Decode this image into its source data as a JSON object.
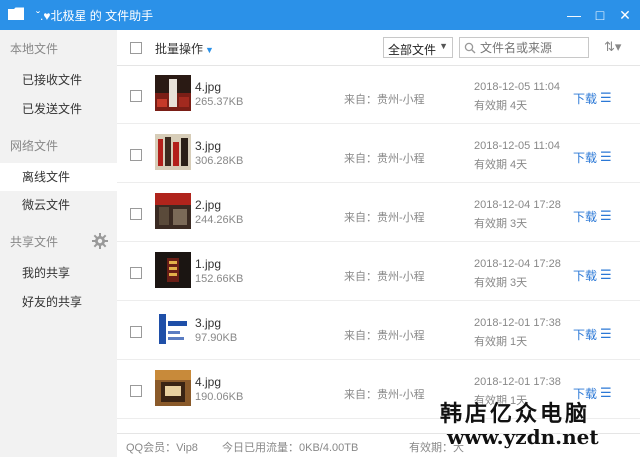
{
  "window": {
    "title": "ˇ.♥北极星 的 文件助手",
    "minimize_glyph": "—",
    "maximize_glyph": "□",
    "close_glyph": "✕",
    "accent_color": "#2b91e8"
  },
  "sidebar": {
    "sections": [
      {
        "label": "本地文件",
        "items": [
          {
            "label": "已接收文件"
          },
          {
            "label": "已发送文件"
          }
        ]
      },
      {
        "label": "网络文件",
        "items": [
          {
            "label": "离线文件",
            "active": true
          },
          {
            "label": "微云文件"
          }
        ]
      },
      {
        "label": "共享文件",
        "icon": "gear-icon",
        "items": [
          {
            "label": "我的共享"
          },
          {
            "label": "好友的共享"
          }
        ]
      }
    ]
  },
  "toolbar": {
    "batch_label": "批量操作",
    "filter_value": "全部文件",
    "search_placeholder": "文件名或来源",
    "sort_glyph": "⇅▾"
  },
  "files": [
    {
      "name": "4.jpg",
      "size": "265.37KB",
      "source": "来自：贵州-小程",
      "date": "2018-12-05 11:04",
      "validity": "有效期 4天",
      "action": "下载",
      "thumb": "dark-red"
    },
    {
      "name": "3.jpg",
      "size": "306.28KB",
      "source": "来自：贵州-小程",
      "date": "2018-12-05 11:04",
      "validity": "有效期 4天",
      "action": "下载",
      "thumb": "red-bars"
    },
    {
      "name": "2.jpg",
      "size": "244.26KB",
      "source": "来自：贵州-小程",
      "date": "2018-12-04 17:28",
      "validity": "有效期 3天",
      "action": "下载",
      "thumb": "red-dark"
    },
    {
      "name": "1.jpg",
      "size": "152.66KB",
      "source": "来自：贵州-小程",
      "date": "2018-12-04 17:28",
      "validity": "有效期 3天",
      "action": "下载",
      "thumb": "dark"
    },
    {
      "name": "3.jpg",
      "size": "97.90KB",
      "source": "来自：贵州-小程",
      "date": "2018-12-01 17:38",
      "validity": "有效期 1天",
      "action": "下载",
      "thumb": "blue-white"
    },
    {
      "name": "4.jpg",
      "size": "190.06KB",
      "source": "来自：贵州-小程",
      "date": "2018-12-01 17:38",
      "validity": "有效期 1天",
      "action": "下载",
      "thumb": "orange"
    }
  ],
  "status": {
    "vip": "QQ会员：Vip8",
    "flow": "今日已用流量：0KB/4.00TB",
    "validity": "有效期：大"
  },
  "watermark": {
    "line1": "韩店亿众电脑",
    "line2": "www.yzdn.net"
  }
}
